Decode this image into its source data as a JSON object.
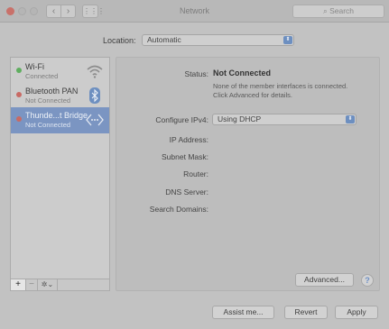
{
  "window": {
    "title": "Network",
    "search_placeholder": "Search",
    "nav_back": "‹",
    "nav_forward": "›",
    "grid_glyph": "⋮⋮⋮"
  },
  "location": {
    "label": "Location:",
    "value": "Automatic"
  },
  "services": [
    {
      "name": "Wi-Fi",
      "status": "Connected",
      "dot_color": "#5fae5f",
      "icon": "wifi-icon",
      "selected": false
    },
    {
      "name": "Bluetooth PAN",
      "status": "Not Connected",
      "dot_color": "#c86a64",
      "icon": "bluetooth-icon",
      "selected": false
    },
    {
      "name": "Thunde...t Bridge",
      "status": "Not Connected",
      "dot_color": "#c86a64",
      "icon": "thunderbolt-bridge-icon",
      "selected": true
    }
  ],
  "sidebar_tools": {
    "add": "+",
    "remove": "−",
    "gear": "✲⌄"
  },
  "detail": {
    "status_label": "Status:",
    "status_value": "Not Connected",
    "status_desc_line1": "None of the member interfaces is connected.",
    "status_desc_line2": "Click Advanced for details.",
    "configure_label": "Configure IPv4:",
    "configure_value": "Using DHCP",
    "ip_label": "IP Address:",
    "subnet_label": "Subnet Mask:",
    "router_label": "Router:",
    "dns_label": "DNS Server:",
    "search_domains_label": "Search Domains:",
    "advanced_button": "Advanced...",
    "help_glyph": "?"
  },
  "footer": {
    "assist_button": "Assist me...",
    "revert_button": "Revert",
    "apply_button": "Apply"
  },
  "colors": {
    "selection": "#7b95c2",
    "accent": "#6d8fc0"
  }
}
